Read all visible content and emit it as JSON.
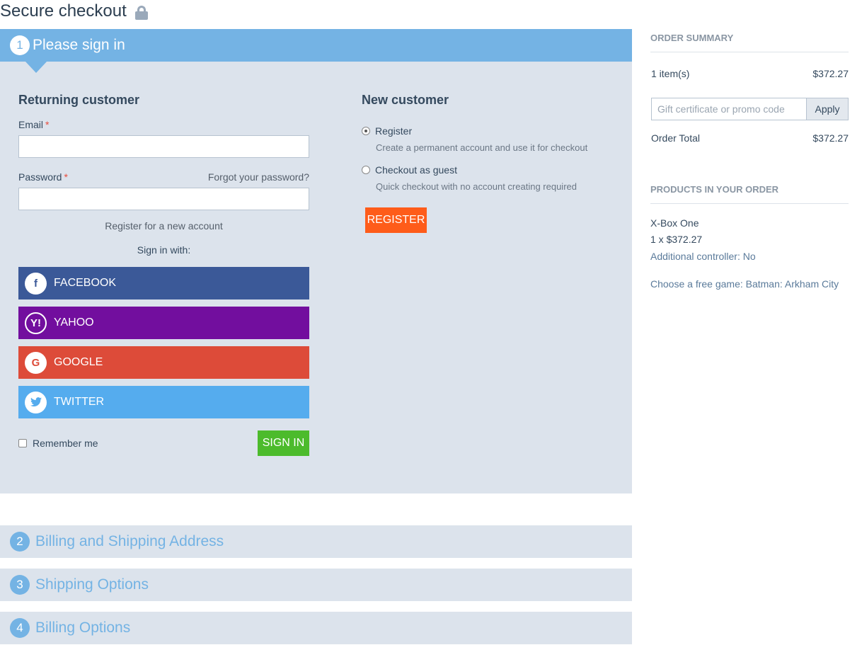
{
  "page": {
    "title": "Secure checkout"
  },
  "step1": {
    "number": "1",
    "title": "Please sign in",
    "returning": {
      "heading": "Returning customer",
      "email_label": "Email",
      "required_mark": "*",
      "email_value": "",
      "password_label": "Password",
      "forgot_link": "Forgot your password?",
      "password_value": "",
      "register_link": "Register for a new account",
      "sign_in_with": "Sign in with:",
      "social": {
        "facebook": "FACEBOOK",
        "yahoo": "YAHOO",
        "google": "GOOGLE",
        "twitter": "TWITTER"
      },
      "remember_me": "Remember me",
      "sign_in_button": "SIGN IN"
    },
    "new_customer": {
      "heading": "New customer",
      "register_label": "Register",
      "register_desc": "Create a permanent account and use it for checkout",
      "guest_label": "Checkout as guest",
      "guest_desc": "Quick checkout with no account creating required",
      "register_button": "REGISTER"
    }
  },
  "steps": [
    {
      "number": "2",
      "title": "Billing and Shipping Address"
    },
    {
      "number": "3",
      "title": "Shipping Options"
    },
    {
      "number": "4",
      "title": "Billing Options"
    }
  ],
  "summary": {
    "heading": "ORDER SUMMARY",
    "items_label": "1 item(s)",
    "items_total": "$372.27",
    "promo_placeholder": "Gift certificate or promo code",
    "apply_button": "Apply",
    "order_total_label": "Order Total",
    "order_total_value": "$372.27",
    "products_heading": "PRODUCTS IN YOUR ORDER",
    "product": {
      "name": "X-Box One",
      "qty_price": "1 x $372.27",
      "option1": "Additional controller: No",
      "option2": "Choose a free game: Batman: Arkham City"
    }
  },
  "colors": {
    "step_active": "#74b3e4",
    "panel_bg": "#dce3ec",
    "facebook": "#3b5998",
    "yahoo": "#720e9e",
    "google": "#dd4b39",
    "twitter": "#55acee",
    "sign_in": "#4cbb2c",
    "register": "#fe5c1a"
  }
}
